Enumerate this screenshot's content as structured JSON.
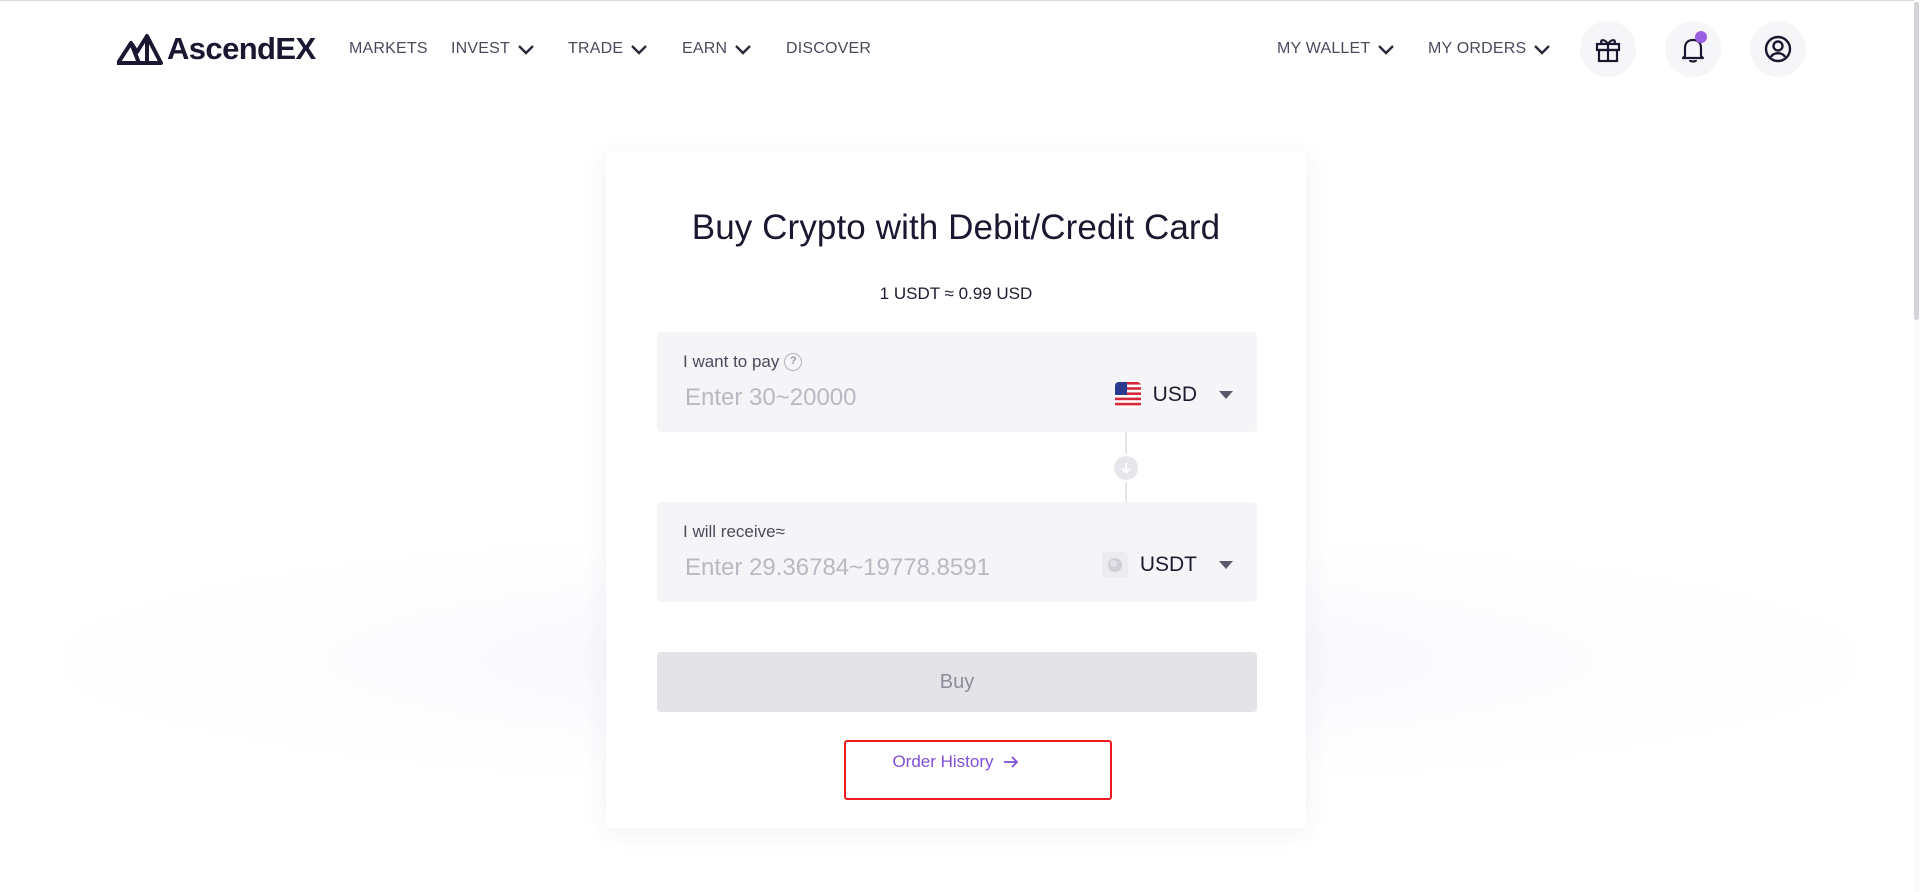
{
  "header": {
    "brand": "AscendEX",
    "nav": [
      {
        "label": "MARKETS",
        "dropdown": false
      },
      {
        "label": "INVEST",
        "dropdown": true
      },
      {
        "label": "TRADE",
        "dropdown": true
      },
      {
        "label": "EARN",
        "dropdown": true
      },
      {
        "label": "DISCOVER",
        "dropdown": false
      }
    ],
    "right_nav": [
      {
        "label": "MY WALLET",
        "dropdown": true
      },
      {
        "label": "MY ORDERS",
        "dropdown": true
      }
    ],
    "icons": [
      "gift-icon",
      "bell-icon",
      "user-circle-icon"
    ],
    "notification_dot_color": "#9a5fe0"
  },
  "card": {
    "title": "Buy Crypto with Debit/Credit Card",
    "rate": "1 USDT ≈ 0.99 USD",
    "pay": {
      "label": "I want to pay",
      "placeholder": "Enter 30~20000",
      "currency": "USD",
      "currency_icon": "us-flag-icon"
    },
    "receive": {
      "label": "I will receive≈",
      "placeholder": "Enter 29.36784~19778.8591",
      "currency": "USDT",
      "currency_icon": "usdt-coin-icon"
    },
    "buy_label": "Buy",
    "order_history_label": "Order History"
  },
  "colors": {
    "accent": "#7f4fd9",
    "highlight": "#ea1c1c",
    "button_disabled_bg": "#e3e3e8",
    "field_bg": "#f5f5f8"
  }
}
